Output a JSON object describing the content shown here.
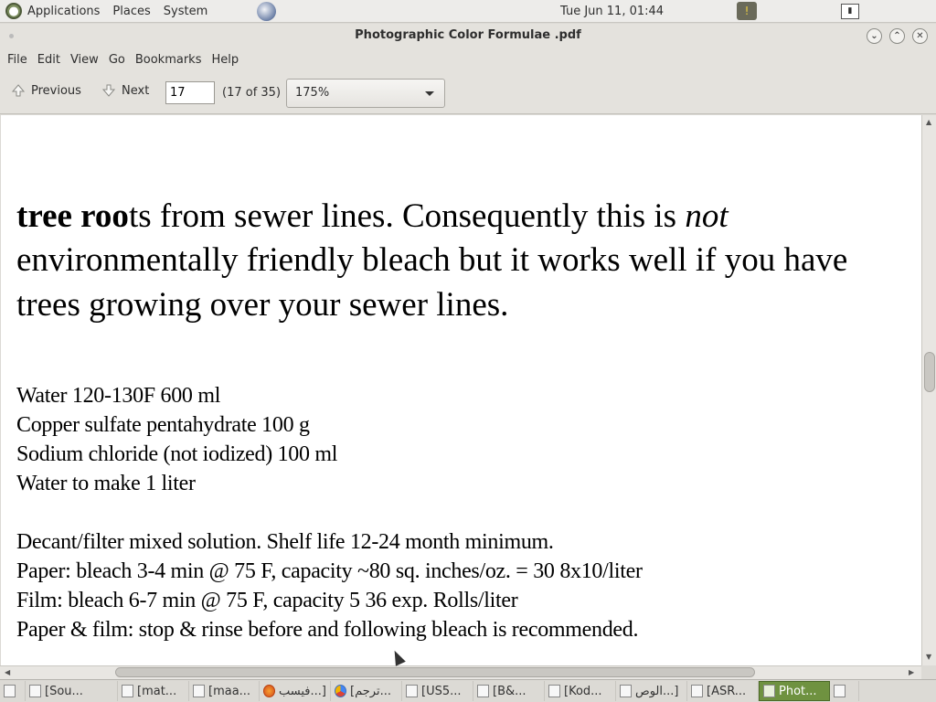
{
  "top_panel": {
    "menus": [
      "Applications",
      "Places",
      "System"
    ],
    "clock": "Tue Jun 11, 01:44"
  },
  "window": {
    "title": "Photographic Color Formulae .pdf"
  },
  "menubar": {
    "items": [
      "File",
      "Edit",
      "View",
      "Go",
      "Bookmarks",
      "Help"
    ]
  },
  "toolbar": {
    "previous_label": "Previous",
    "next_label": "Next",
    "page_value": "17",
    "page_of": "(17 of 35)",
    "zoom_value": "175%"
  },
  "document": {
    "line1_bold": "tree roo",
    "line1_rest": "ts from sewer lines.  Consequently this is ",
    "line1_italic": "not",
    "line2": "environmentally friendly bleach but it works well if you have",
    "line3": "trees growing over your sewer lines.",
    "formula": [
      "Water 120-130F   600 ml",
      "Copper sulfate pentahydrate  100 g",
      "Sodium chloride (not iodized) 100 ml",
      "Water to make     1 liter"
    ],
    "notes": [
      "Decant/filter mixed solution.  Shelf life 12-24 month minimum.",
      "Paper:  bleach 3-4 min @ 75 F, capacity ~80 sq. inches/oz. = 30 8x10/liter",
      "Film:    bleach 6-7 min @ 75 F, capacity 5 36 exp. Rolls/liter",
      "Paper & film: stop & rinse before and following bleach is recommended."
    ]
  },
  "taskbar": {
    "tasks": [
      {
        "label": "[Sou...",
        "icon": "file-icon"
      },
      {
        "label": "[mat...",
        "icon": "file-icon"
      },
      {
        "label": "[maa...",
        "icon": "file-icon"
      },
      {
        "label": "فيسب...]",
        "icon": "firefox-icon"
      },
      {
        "label": "[ترجم...",
        "icon": "chrome-icon"
      },
      {
        "label": "[US5...",
        "icon": "file-icon"
      },
      {
        "label": "[B&...",
        "icon": "file-icon"
      },
      {
        "label": "[Kod...",
        "icon": "file-icon"
      },
      {
        "label": "الوص...]",
        "icon": "file-icon"
      },
      {
        "label": "[ASR...",
        "icon": "terminal-icon"
      },
      {
        "label": "Phot...",
        "icon": "pdf-icon",
        "active": true
      }
    ]
  }
}
